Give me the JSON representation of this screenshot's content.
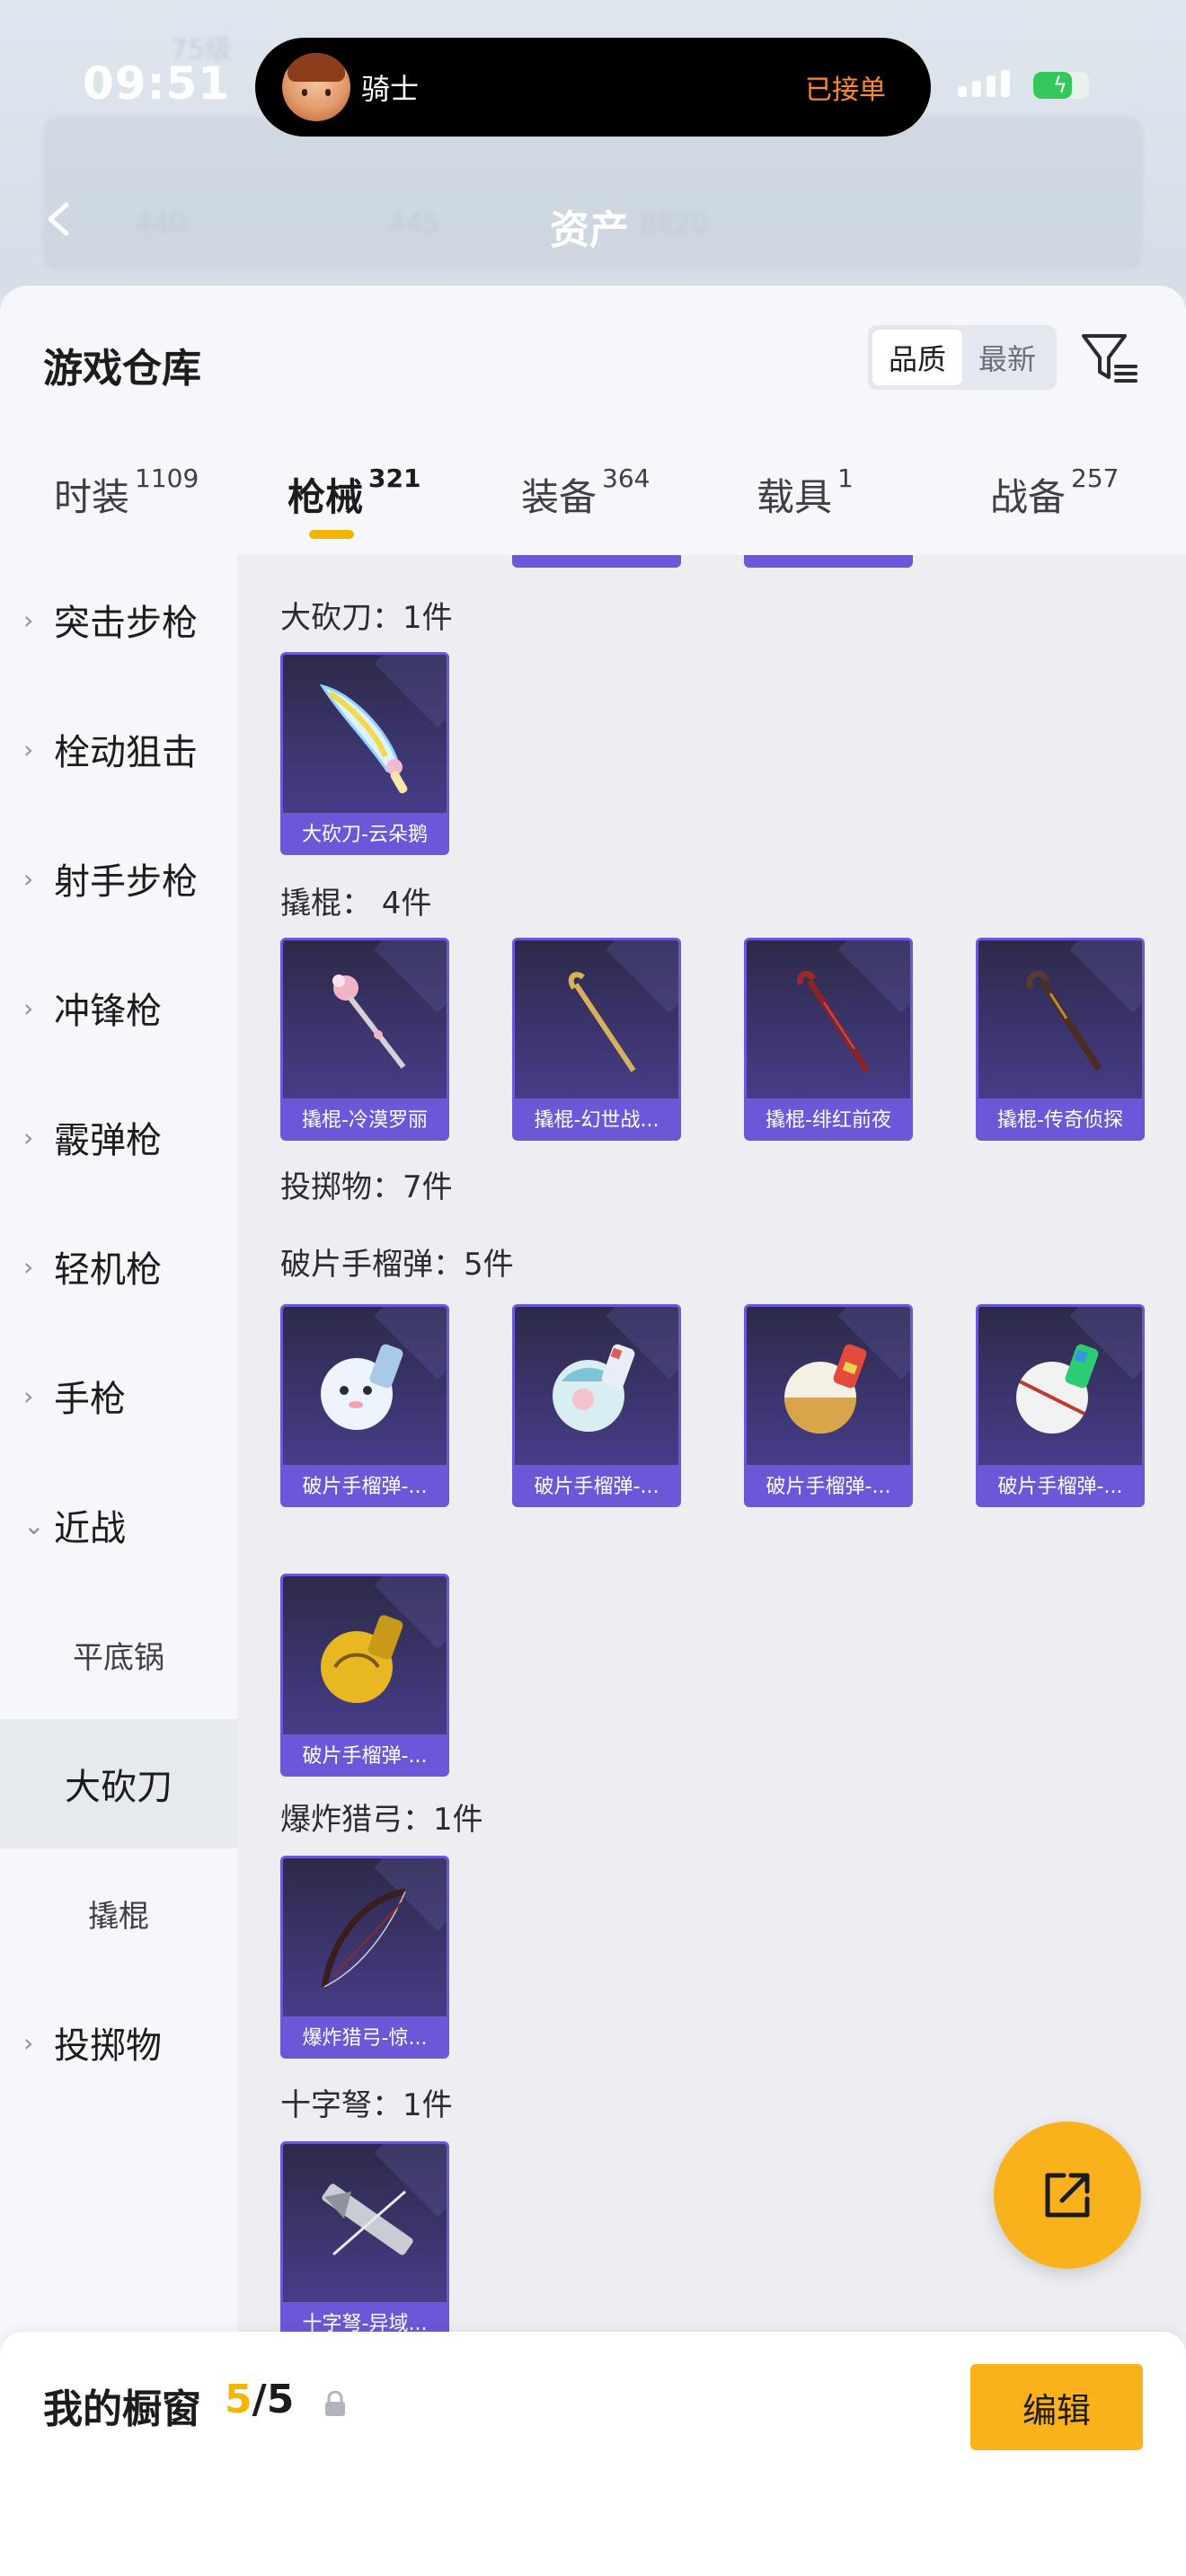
{
  "status_bar": {
    "time": "09:51"
  },
  "island": {
    "name": "骑士",
    "status": "已接单"
  },
  "background_header": {
    "level": "75级",
    "title": "资产",
    "values": [
      "440",
      "445",
      "8820"
    ]
  },
  "sheet": {
    "title": "游戏仓库",
    "sort_options": [
      "品质",
      "最新"
    ],
    "selected_sort": "品质"
  },
  "tabs": [
    {
      "label": "时装",
      "count": "1109"
    },
    {
      "label": "枪械",
      "count": "321",
      "active": true
    },
    {
      "label": "装备",
      "count": "364"
    },
    {
      "label": "载具",
      "count": "1"
    },
    {
      "label": "战备",
      "count": "257"
    }
  ],
  "sidebar": {
    "items": [
      {
        "label": "突击步枪",
        "chevron": "›"
      },
      {
        "label": "栓动狙击",
        "chevron": "›"
      },
      {
        "label": "射手步枪",
        "chevron": "›"
      },
      {
        "label": "冲锋枪",
        "chevron": "›"
      },
      {
        "label": "霰弹枪",
        "chevron": "›"
      },
      {
        "label": "轻机枪",
        "chevron": "›"
      },
      {
        "label": "手枪",
        "chevron": "›"
      },
      {
        "label": "近战",
        "chevron": "⌄",
        "expanded": true
      },
      {
        "label": "平底锅",
        "sub": true
      },
      {
        "label": "大砍刀",
        "sub": true,
        "selected": true
      },
      {
        "label": "撬棍",
        "sub": true
      },
      {
        "label": "投掷物",
        "chevron": "›"
      }
    ]
  },
  "content": {
    "groups": [
      {
        "title": "大砍刀：1件",
        "items": [
          "大砍刀-云朵鹅"
        ]
      },
      {
        "title": "撬棍： 4件",
        "items": [
          "撬棍-冷漠罗丽",
          "撬棍-幻世战...",
          "撬棍-绯红前夜",
          "撬棍-传奇侦探"
        ]
      },
      {
        "title": "投掷物：7件",
        "items": []
      },
      {
        "title": "破片手榴弹：5件",
        "items": [
          "破片手榴弹-...",
          "破片手榴弹-...",
          "破片手榴弹-...",
          "破片手榴弹-...",
          "破片手榴弹-..."
        ]
      },
      {
        "title": "爆炸猎弓：1件",
        "items": [
          "爆炸猎弓-惊..."
        ]
      },
      {
        "title": "十字弩：1件",
        "items": [
          "十字弩-异域..."
        ]
      }
    ]
  },
  "bottom_bar": {
    "label": "我的橱窗",
    "current": "5",
    "separator": "/",
    "total": "5",
    "edit_label": "编辑"
  },
  "colors": {
    "accent": "#f9b21c",
    "card_border": "#6a58d8",
    "card_bg": "#3f3775",
    "status_orange": "#ff8a2a"
  },
  "icons": [
    "back-arrow-icon",
    "filter-icon",
    "lock-icon",
    "share-icon",
    "chevron-right-icon",
    "chevron-down-icon"
  ]
}
